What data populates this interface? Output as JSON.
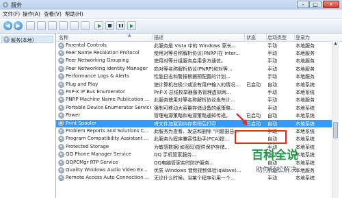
{
  "window": {
    "title": "服务"
  },
  "menu": [
    "文件(F)",
    "操作(A)",
    "查看(V)",
    "帮助(H)"
  ],
  "tree": {
    "root_label": "服务(本地)"
  },
  "columns": {
    "name": "名称",
    "desc": "描述",
    "status": "状态",
    "startup": "启动类型",
    "login": "登录为"
  },
  "services": [
    {
      "name": "Parental Controls",
      "desc": "此服务是 Vista 中的 Windows 家长...",
      "status": "",
      "startup": "手动",
      "login": "本地服务"
    },
    {
      "name": "Peer Name Resolution Protocol",
      "desc": "使用对等名称解析协议(PNRP)在 Inter...",
      "status": "",
      "startup": "手动",
      "login": "本地服务"
    },
    {
      "name": "Peer Networking Grouping",
      "desc": "使用对等分组服务启用多方通信。",
      "status": "",
      "startup": "手动",
      "login": "本地服务"
    },
    {
      "name": "Peer Networking Identity Manager",
      "desc": "向对等名称解析协议(PNRP)和对等...",
      "status": "",
      "startup": "手动",
      "login": "本地服务"
    },
    {
      "name": "Performance Logs & Alerts",
      "desc": "性能日志和警报根据预配置的计划...",
      "status": "",
      "startup": "手动",
      "login": "本地服务"
    },
    {
      "name": "Plug and Play",
      "desc": "使计算机在极少或没有用户输入的情况...",
      "status": "已启动",
      "startup": "自动",
      "login": "本地系统"
    },
    {
      "name": "PnP-X IP Bus Enumerator",
      "desc": "PnP-X 总线枚举器服务管理虚拟网...",
      "status": "",
      "startup": "手动",
      "login": "本地系统"
    },
    {
      "name": "PNRP Machine Name Publication ...",
      "desc": "此服务使用对等名称解析协议发布计...",
      "status": "",
      "startup": "手动",
      "login": "本地服务"
    },
    {
      "name": "Portable Device Enumerator Service",
      "desc": "强制可移动大容量存储设备的组策略...",
      "status": "",
      "startup": "手动",
      "login": "本地系统"
    },
    {
      "name": "Power",
      "desc": "管理电源策略和电源策略通知传递。",
      "status": "已启动",
      "startup": "自动",
      "login": "本地系统"
    },
    {
      "name": "Print Spooler",
      "desc": "将文件加载到内存供稍后打印",
      "status": "已启动",
      "startup": "自动",
      "login": "本地系统",
      "selected": true
    },
    {
      "name": "Problem Reports and Solutions C...",
      "desc": "此服务为查看、发送和删除 \"问题报告...",
      "status": "",
      "startup": "手动",
      "login": "本地系统"
    },
    {
      "name": "Program Compatibility Assistant ...",
      "desc": "此服务为程序兼容性助手(PCA)提...",
      "status": "",
      "startup": "自动",
      "login": "本地系统"
    },
    {
      "name": "Protected Storage",
      "desc": "为敏感数据(如密码)提供保护存储...",
      "status": "",
      "startup": "手动",
      "login": "本地系统"
    },
    {
      "name": "QQ Phone Manager Service",
      "desc": "QQ 手机管家服务...",
      "status": "",
      "startup": "手动",
      "login": "本地系统"
    },
    {
      "name": "QQPCMgr RTP Service",
      "desc": "QQ电脑管家实时防护服务...",
      "status": "",
      "startup": "自动",
      "login": "本地系统"
    },
    {
      "name": "Quality Windows Audio Video Ex...",
      "desc": "优质 Windows 音频视频体验(qWave)...",
      "status": "",
      "startup": "手动",
      "login": "本地服务"
    },
    {
      "name": "Remote Access Auto Connection ...",
      "desc": "无论什么时候，当某个程序引用一个...",
      "status": "",
      "startup": "手动",
      "login": "本地系统"
    }
  ],
  "watermark": {
    "logo_text": "百科全说",
    "slogan": "助你轻松解决"
  }
}
